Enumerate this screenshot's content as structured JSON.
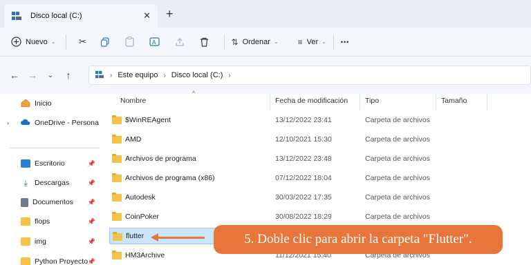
{
  "window": {
    "tab_title": "Disco local (C:)",
    "tab_close": "✕",
    "new_tab": "+"
  },
  "toolbar": {
    "new_label": "Nuevo",
    "sort_label": "Ordenar",
    "view_label": "Ver",
    "more": "•••"
  },
  "address": {
    "crumbs": [
      "Este equipo",
      "Disco local (C:)"
    ]
  },
  "sidebar": {
    "items": [
      {
        "label": "Inicio",
        "icon": "home-icon"
      },
      {
        "label": "OneDrive - Persona",
        "icon": "cloud-icon"
      },
      {
        "label": "Escritorio",
        "icon": "desktop-icon"
      },
      {
        "label": "Descargas",
        "icon": "download-icon"
      },
      {
        "label": "Documentos",
        "icon": "documents-icon"
      },
      {
        "label": "flops",
        "icon": "folder-icon"
      },
      {
        "label": "img",
        "icon": "folder-icon"
      },
      {
        "label": "Python Proyecto",
        "icon": "folder-icon"
      }
    ]
  },
  "columns": {
    "name": "Nombre",
    "date": "Fecha de modificación",
    "type": "Tipo",
    "size": "Tamaño"
  },
  "files": [
    {
      "name": "$WinREAgent",
      "date": "13/12/2022 23:41",
      "type": "Carpeta de archivos"
    },
    {
      "name": "AMD",
      "date": "12/10/2021 15:30",
      "type": "Carpeta de archivos"
    },
    {
      "name": "Archivos de programa",
      "date": "13/12/2022 23:48",
      "type": "Carpeta de archivos"
    },
    {
      "name": "Archivos de programa (x86)",
      "date": "07/12/2022 18:04",
      "type": "Carpeta de archivos"
    },
    {
      "name": "Autodesk",
      "date": "30/03/2022 17:35",
      "type": "Carpeta de archivos"
    },
    {
      "name": "CoinPoker",
      "date": "30/08/2022 18:29",
      "type": "Carpeta de archivos"
    },
    {
      "name": "flutter",
      "date": "",
      "type": ""
    },
    {
      "name": "HM3Archive",
      "date": "11/12/2021 15:40",
      "type": "Carpeta de archivos"
    }
  ],
  "callout": {
    "text": "5. Doble clic para abrir la carpeta \"Flutter\"."
  },
  "colors": {
    "accent": "#e8763b",
    "folder": "#f4c249",
    "selection": "#cce4f7"
  }
}
